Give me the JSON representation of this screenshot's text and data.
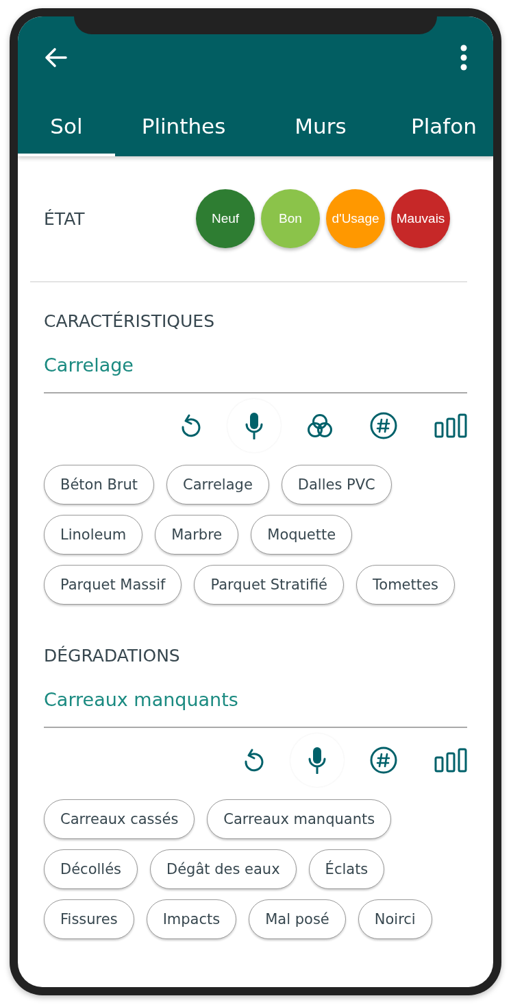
{
  "app_bar": {
    "tabs": [
      {
        "label": "Sol",
        "selected": true
      },
      {
        "label": "Plinthes",
        "selected": false
      },
      {
        "label": "Murs",
        "selected": false
      },
      {
        "label": "Plafon",
        "selected": false
      }
    ]
  },
  "etat": {
    "title": "ÉTAT",
    "options": [
      {
        "label": "Neuf",
        "color": "#2e7d32"
      },
      {
        "label": "Bon",
        "color": "#8bc34a"
      },
      {
        "label": "d'Usage",
        "color": "#ff9800"
      },
      {
        "label": "Mauvais",
        "color": "#c62828"
      }
    ]
  },
  "sections": [
    {
      "title": "CARACTÉRISTIQUES",
      "value": "Carrelage",
      "tools": [
        {
          "kind": "undo"
        },
        {
          "kind": "mic"
        },
        {
          "kind": "colors"
        },
        {
          "kind": "hash"
        },
        {
          "kind": "bars"
        }
      ],
      "chips": [
        "Béton Brut",
        "Carrelage",
        "Dalles PVC",
        "Linoleum",
        "Marbre",
        "Moquette",
        "Parquet Massif",
        "Parquet Stratifié",
        "Tomettes"
      ]
    },
    {
      "title": "DÉGRADATIONS",
      "value": "Carreaux manquants",
      "tools": [
        {
          "kind": "undo"
        },
        {
          "kind": "mic"
        },
        {
          "kind": "hash"
        },
        {
          "kind": "bars"
        }
      ],
      "chips": [
        "Carreaux cassés",
        "Carreaux manquants",
        "Décollés",
        "Dégât des eaux",
        "Éclats",
        "Fissures",
        "Impacts",
        "Mal posé",
        "Noirci"
      ]
    }
  ]
}
